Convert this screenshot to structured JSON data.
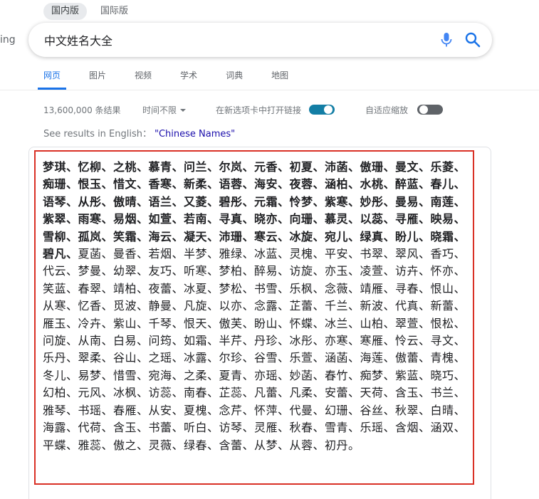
{
  "region_tabs": [
    {
      "label": "国内版",
      "active": true
    },
    {
      "label": "国际版",
      "active": false
    }
  ],
  "logo_fragment": "ing",
  "search": {
    "value": "中文姓名大全"
  },
  "nav_tabs": [
    "网页",
    "图片",
    "视频",
    "学术",
    "词典",
    "地图"
  ],
  "tools": {
    "result_count": "13,600,000 条结果",
    "time_filter": "时间不限",
    "new_tab_label": "在新选项卡中打开链接",
    "new_tab_on": true,
    "adaptive_zoom_label": "自适应缩放",
    "adaptive_zoom_on": false
  },
  "see_results": {
    "prefix": "See results in English：",
    "link": "\"Chinese Names\""
  },
  "answer": {
    "bold_text": "梦琪、忆柳、之桃、慕青、问兰、尔岚、元香、初夏、沛菡、傲珊、曼文、乐菱、痴珊、恨玉、惜文、香寒、新柔、语蓉、海安、夜蓉、涵柏、水桃、醉蓝、春儿、语琴、从彤、傲晴、语兰、又菱、碧彤、元霜、怜梦、紫寒、妙彤、曼易、南莲、紫翠、雨寒、易烟、如萱、若南、寻真、晓亦、向珊、慕灵、以蕊、寻雁、映易、雪柳、孤岚、笑霜、海云、凝天、沛珊、寒云、冰旋、宛儿、绿真、盼儿、晓霜、碧凡、",
    "normal_text": "夏菡、曼香、若烟、半梦、雅绿、冰蓝、灵槐、平安、书翠、翠风、香巧、代云、梦曼、幼翠、友巧、听寒、梦柏、醉易、访旋、亦玉、凌萱、访卉、怀亦、笑蓝、春翠、靖柏、夜蕾、冰夏、梦松、书雪、乐枫、念薇、靖雁、寻春、恨山、从寒、忆香、觅波、静曼、凡旋、以亦、念露、芷蕾、千兰、新波、代真、新蕾、雁玉、冷卉、紫山、千琴、恨天、傲芙、盼山、怀蝶、冰兰、山柏、翠萱、恨松、问旋、从南、白易、问筠、如霜、半芹、丹珍、冰彤、亦寒、寒雁、怜云、寻文、乐丹、翠柔、谷山、之瑶、冰露、尔珍、谷雪、乐萱、涵菡、海莲、傲蕾、青槐、冬儿、易梦、惜雪、宛海、之柔、夏青、亦瑶、妙菡、春竹、痴梦、紫蓝、晓巧、幻柏、元风、冰枫、访蕊、南春、芷蕊、凡蕾、凡柔、安蕾、天荷、含玉、书兰、雅琴、书瑶、春雁、从安、夏槐、念芹、怀萍、代曼、幻珊、谷丝、秋翠、白晴、海露、代荷、含玉、书蕾、听白、访琴、灵雁、秋春、雪青、乐瑶、含烟、涵双、平蝶、雅蕊、傲之、灵薇、绿春、含蕾、从梦、从蓉、初丹。"
  },
  "colors": {
    "accent": "#1a73e8",
    "toggle_on": "#137ea5",
    "highlight_border": "#d93025",
    "link": "#1a0dab"
  }
}
